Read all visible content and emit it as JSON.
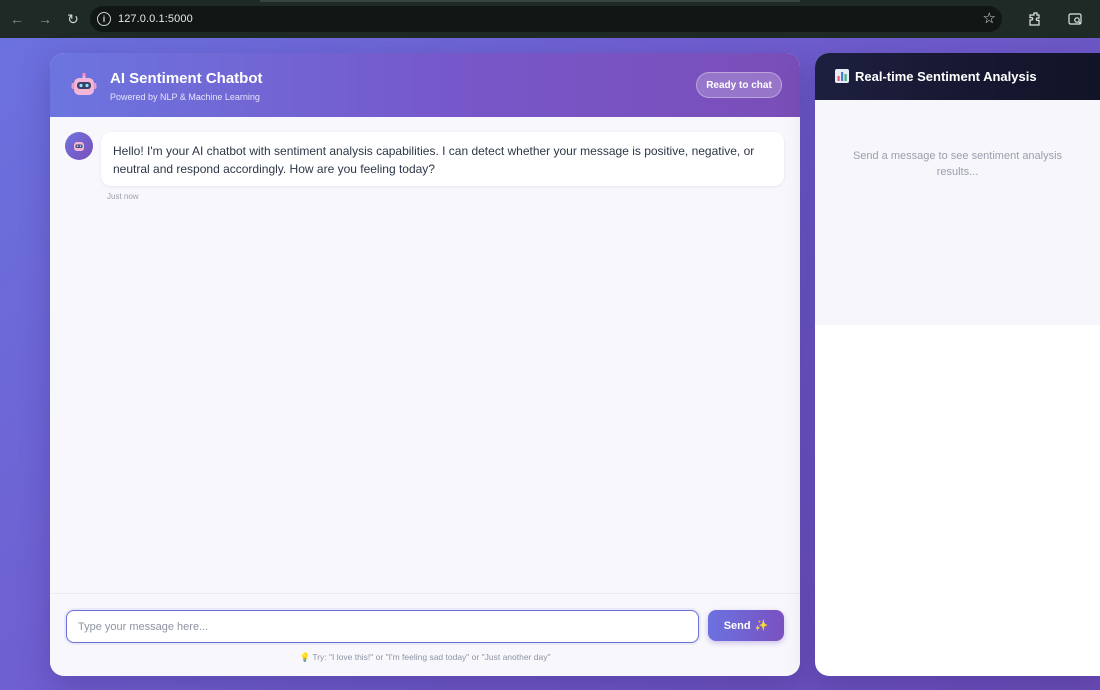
{
  "browser": {
    "url": "127.0.0.1:5000"
  },
  "header": {
    "title": "AI Sentiment Chatbot",
    "subtitle": "Powered by NLP & Machine Learning",
    "status": "Ready to chat"
  },
  "messages": [
    {
      "sender": "bot",
      "text": "Hello! I'm your AI chatbot with sentiment analysis capabilities. I can detect whether your message is positive, negative, or neutral and respond accordingly. How are you feeling today?",
      "time": "Just now"
    }
  ],
  "input": {
    "placeholder": "Type your message here...",
    "value": "",
    "send_label": "Send",
    "send_icon": "✨",
    "hint_icon": "💡",
    "hint": "Try: \"I love this!\" or \"I'm feeling sad today\" or \"Just another day\""
  },
  "sentiment": {
    "title": "Real-time Sentiment Analysis",
    "empty_text": "Send a message to see sentiment analysis results..."
  },
  "colors": {
    "accent": "#6b72e0",
    "accent_end": "#7a4eb8",
    "sentiment_header": "#1d1f3f"
  }
}
